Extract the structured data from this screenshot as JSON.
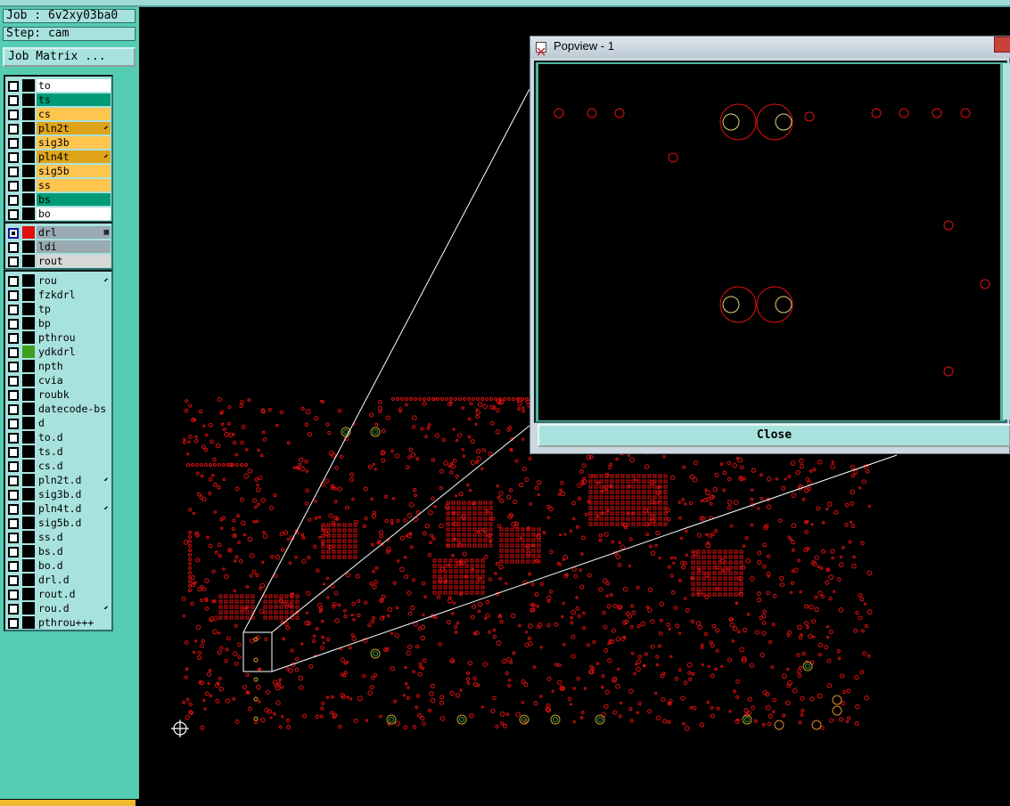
{
  "job_label": "Job : 6v2xy03ba0",
  "step_label": "Step: cam",
  "job_matrix_button": "Job Matrix ...",
  "layer_groups": [
    {
      "layers": [
        {
          "name": "to",
          "bg": "#ffffff",
          "swatch": "#000000",
          "locked": false
        },
        {
          "name": "ts",
          "bg": "#009b76",
          "swatch": "#000000",
          "locked": false
        },
        {
          "name": "cs",
          "bg": "#ffc54e",
          "swatch": "#000000",
          "locked": false
        },
        {
          "name": "pln2t",
          "bg": "#dfa31a",
          "swatch": "#000000",
          "locked": true
        },
        {
          "name": "sig3b",
          "bg": "#ffc54e",
          "swatch": "#000000",
          "locked": false
        },
        {
          "name": "pln4t",
          "bg": "#dfa31a",
          "swatch": "#000000",
          "locked": true
        },
        {
          "name": "sig5b",
          "bg": "#ffc54e",
          "swatch": "#000000",
          "locked": false
        },
        {
          "name": "ss",
          "bg": "#ffc54e",
          "swatch": "#000000",
          "locked": false
        },
        {
          "name": "bs",
          "bg": "#009b76",
          "swatch": "#000000",
          "locked": false
        },
        {
          "name": "bo",
          "bg": "#ffffff",
          "swatch": "#000000",
          "locked": false
        }
      ]
    },
    {
      "layers": [
        {
          "name": "drl",
          "bg": "#9aaab2",
          "swatch": "#e01010",
          "locked": false,
          "active": true
        },
        {
          "name": "ldi",
          "bg": "#9aaab2",
          "swatch": "#000000",
          "locked": false
        },
        {
          "name": "rout",
          "bg": "#d8d8d8",
          "swatch": "#000000",
          "locked": false
        }
      ]
    },
    {
      "layers": [
        {
          "name": "rou",
          "bg": "#a8e2de",
          "swatch": "#000000",
          "locked": true
        },
        {
          "name": "fzkdrl",
          "bg": "#a8e2de",
          "swatch": "#000000",
          "locked": false
        },
        {
          "name": "tp",
          "bg": "#a8e2de",
          "swatch": "#000000",
          "locked": false
        },
        {
          "name": "bp",
          "bg": "#a8e2de",
          "swatch": "#000000",
          "locked": false
        },
        {
          "name": "pthrou",
          "bg": "#a8e2de",
          "swatch": "#000000",
          "locked": false
        },
        {
          "name": "ydkdrl",
          "bg": "#a8e2de",
          "swatch": "#3f9e1c",
          "locked": false
        },
        {
          "name": "npth",
          "bg": "#a8e2de",
          "swatch": "#000000",
          "locked": false
        },
        {
          "name": "cvia",
          "bg": "#a8e2de",
          "swatch": "#000000",
          "locked": false
        },
        {
          "name": "roubk",
          "bg": "#a8e2de",
          "swatch": "#000000",
          "locked": false
        },
        {
          "name": "datecode-bs",
          "bg": "#a8e2de",
          "swatch": "#000000",
          "locked": false
        },
        {
          "name": "d",
          "bg": "#a8e2de",
          "swatch": "#000000",
          "locked": false
        },
        {
          "name": "to.d",
          "bg": "#a8e2de",
          "swatch": "#000000",
          "locked": false
        },
        {
          "name": "ts.d",
          "bg": "#a8e2de",
          "swatch": "#000000",
          "locked": false
        },
        {
          "name": "cs.d",
          "bg": "#a8e2de",
          "swatch": "#000000",
          "locked": false
        },
        {
          "name": "pln2t.d",
          "bg": "#a8e2de",
          "swatch": "#000000",
          "locked": true
        },
        {
          "name": "sig3b.d",
          "bg": "#a8e2de",
          "swatch": "#000000",
          "locked": false
        },
        {
          "name": "pln4t.d",
          "bg": "#a8e2de",
          "swatch": "#000000",
          "locked": true
        },
        {
          "name": "sig5b.d",
          "bg": "#a8e2de",
          "swatch": "#000000",
          "locked": false
        },
        {
          "name": "ss.d",
          "bg": "#a8e2de",
          "swatch": "#000000",
          "locked": false
        },
        {
          "name": "bs.d",
          "bg": "#a8e2de",
          "swatch": "#000000",
          "locked": false
        },
        {
          "name": "bo.d",
          "bg": "#a8e2de",
          "swatch": "#000000",
          "locked": false
        },
        {
          "name": "drl.d",
          "bg": "#a8e2de",
          "swatch": "#000000",
          "locked": false
        },
        {
          "name": "rout.d",
          "bg": "#a8e2de",
          "swatch": "#000000",
          "locked": false
        },
        {
          "name": "rou.d",
          "bg": "#a8e2de",
          "swatch": "#000000",
          "locked": true
        },
        {
          "name": "pthrou+++",
          "bg": "#a8e2de",
          "swatch": "#000000",
          "locked": false
        }
      ]
    }
  ],
  "popview": {
    "title": "Popview - 1",
    "close_button": "Close"
  },
  "colors": {
    "panel": "#55cdb2",
    "panel_light": "#a8e2de",
    "drill_red": "#e01010",
    "canvas_bg": "#000000"
  }
}
